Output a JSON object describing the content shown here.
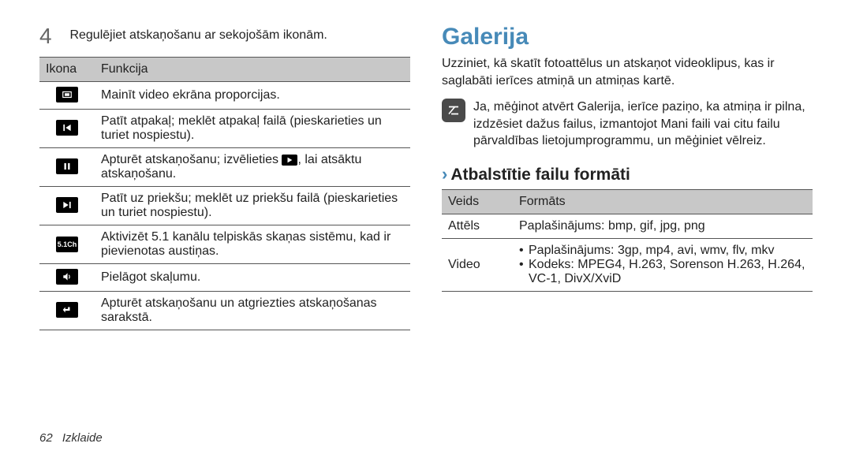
{
  "step": {
    "number": "4",
    "text": "Regulējiet atskaņošanu ar sekojošām ikonām."
  },
  "icon_table": {
    "headers": [
      "Ikona",
      "Funkcija"
    ],
    "rows": [
      {
        "icon": "aspect",
        "text": "Mainīt video ekrāna proporcijas."
      },
      {
        "icon": "prev",
        "text": "Patīt atpakaļ; meklēt atpakaļ failā (pieskarieties un turiet nospiestu)."
      },
      {
        "icon": "pause",
        "text_a": "Apturēt atskaņošanu; izvēlieties ",
        "text_b": ", lai atsāktu atskaņošanu."
      },
      {
        "icon": "next",
        "text": "Patīt uz priekšu; meklēt uz priekšu failā (pieskarieties un turiet nospiestu)."
      },
      {
        "icon": "ch51",
        "text": "Aktivizēt 5.1 kanālu telpiskās skaņas sistēmu, kad ir pievienotas austiņas."
      },
      {
        "icon": "vol",
        "text": "Pielāgot skaļumu."
      },
      {
        "icon": "back",
        "text": "Apturēt atskaņošanu un atgriezties atskaņošanas sarakstā."
      }
    ]
  },
  "right": {
    "title": "Galerija",
    "intro": "Uzziniet, kā skatīt fotoattēlus un atskaņot videoklipus, kas ir saglabāti ierīces atmiņā un atmiņas kartē.",
    "note_a": "Ja, mēģinot atvērt ",
    "note_app1": "Galerija",
    "note_b": ", ierīce paziņo, ka atmiņa ir pilna, izdzēsiet dažus failus, izmantojot ",
    "note_app2": "Mani faili",
    "note_c": " vai citu failu pārvaldības lietojumprogrammu, un mēģiniet vēlreiz.",
    "sub_title": "Atbalstītie failu formāti",
    "fmt_headers": [
      "Veids",
      "Formāts"
    ],
    "fmt_rows": [
      {
        "type": "Attēls",
        "lines": [
          "Paplašinājums: bmp, gif, jpg, png"
        ]
      },
      {
        "type": "Video",
        "lines": [
          "Paplašinājums: 3gp, mp4, avi, wmv, flv, mkv",
          "Kodeks: MPEG4, H.263, Sorenson H.263, H.264, VC-1, DivX/XviD"
        ]
      }
    ]
  },
  "footer": {
    "page": "62",
    "section": "Izklaide"
  }
}
